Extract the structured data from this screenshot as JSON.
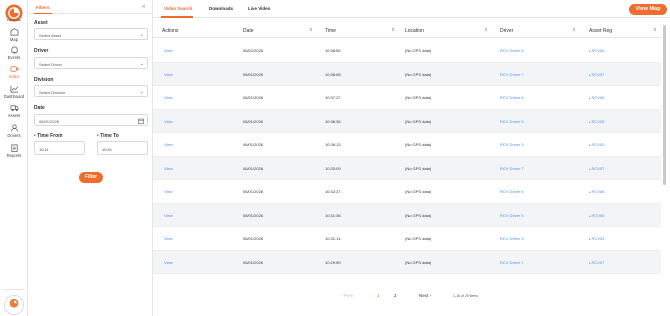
{
  "brand": {
    "name": "FleetView",
    "accent": "#ee6c2c",
    "link": "#4a8fe7"
  },
  "nav": [
    {
      "key": "map",
      "label": "Map",
      "icon": "map-icon"
    },
    {
      "key": "events",
      "label": "Events",
      "icon": "bell-icon"
    },
    {
      "key": "video",
      "label": "Video",
      "icon": "camera-icon",
      "active": true
    },
    {
      "key": "dashboard",
      "label": "Dashboard",
      "icon": "chart-icon"
    },
    {
      "key": "assets",
      "label": "Assets",
      "icon": "truck-icon"
    },
    {
      "key": "drivers",
      "label": "Drivers",
      "icon": "person-icon"
    },
    {
      "key": "reports",
      "label": "Reports",
      "icon": "clipboard-icon"
    }
  ],
  "filters": {
    "tab_label": "Filters",
    "asset_label": "Asset",
    "asset_placeholder": "Select Asset",
    "driver_label": "Driver",
    "driver_placeholder": "Select Driver",
    "division_label": "Division",
    "division_placeholder": "Select Division",
    "date_label": "Date",
    "date_value": "06/01/2026",
    "time_from_label": "Time From",
    "time_from_value": "10:11",
    "time_to_label": "Time To",
    "time_to_value": "10:41",
    "filter_button": "Filter"
  },
  "tabs": [
    {
      "label": "Video Search",
      "active": true
    },
    {
      "label": "Downloads"
    },
    {
      "label": "Live Video"
    }
  ],
  "view_map_button": "View Map",
  "table": {
    "columns": [
      "Actions",
      "Date",
      "Time",
      "Location",
      "Driver",
      "Asset Reg"
    ],
    "rows": [
      [
        "View",
        "06/01/2026",
        "10:38:55",
        "(No GPS data)",
        "RCV Driver 6",
        "RCV06"
      ],
      [
        "View",
        "06/01/2026",
        "10:38:08",
        "(No GPS data)",
        "RCV Driver 7",
        "RCV07"
      ],
      [
        "View",
        "06/01/2026",
        "10:37:27",
        "(No GPS data)",
        "RCV Driver 6",
        "RCV06"
      ],
      [
        "View",
        "06/01/2026",
        "10:36:36",
        "(No GPS data)",
        "RCV Driver 5",
        "RCV05"
      ],
      [
        "View",
        "06/01/2026",
        "10:36:13",
        "(No GPS data)",
        "RCV Driver 3",
        "RCV03"
      ],
      [
        "View",
        "06/01/2026",
        "10:33:09",
        "(No GPS data)",
        "RCV Driver 7",
        "RCV07"
      ],
      [
        "View",
        "06/01/2026",
        "10:32:27",
        "(No GPS data)",
        "RCV Driver 6",
        "RCV06"
      ],
      [
        "View",
        "06/01/2026",
        "10:31:36",
        "(No GPS data)",
        "RCV Driver 5",
        "RCV05"
      ],
      [
        "View",
        "06/01/2026",
        "10:31:14",
        "(No GPS data)",
        "RCV Driver 3",
        "RCV03"
      ],
      [
        "View",
        "06/01/2026",
        "10:29:59",
        "(No GPS data)",
        "RCV Driver 7",
        "RCV07"
      ]
    ]
  },
  "pagination": {
    "prev": "Prev",
    "pages": [
      "1",
      "2"
    ],
    "current": "1",
    "next": "Next",
    "info": "1-16 of 29 items"
  }
}
